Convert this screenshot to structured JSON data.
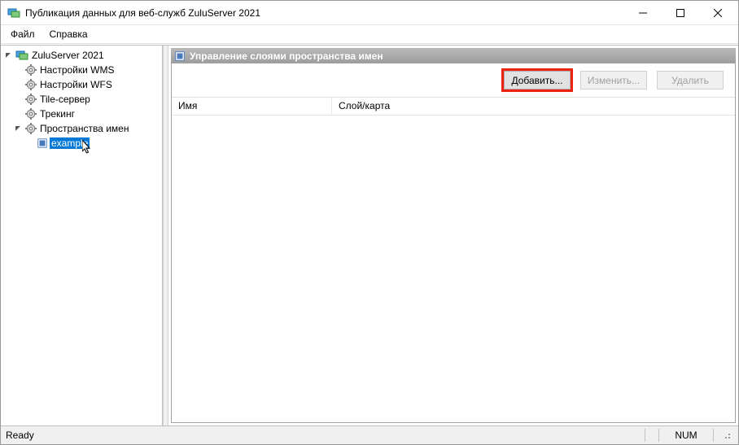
{
  "window": {
    "title": "Публикация данных для веб-служб ZuluServer 2021"
  },
  "menu": {
    "file": "Файл",
    "help": "Справка"
  },
  "tree": {
    "root": "ZuluServer 2021",
    "wms": "Настройки WMS",
    "wfs": "Настройки WFS",
    "tile": "Tile-сервер",
    "tracking": "Трекинг",
    "namespaces": "Пространства имен",
    "example": "example"
  },
  "panel": {
    "title": "Управление слоями пространства имен"
  },
  "buttons": {
    "add": "Добавить...",
    "edit": "Изменить...",
    "delete": "Удалить"
  },
  "table": {
    "col_name": "Имя",
    "col_layer": "Слой/карта"
  },
  "status": {
    "ready": "Ready",
    "num": "NUM"
  }
}
